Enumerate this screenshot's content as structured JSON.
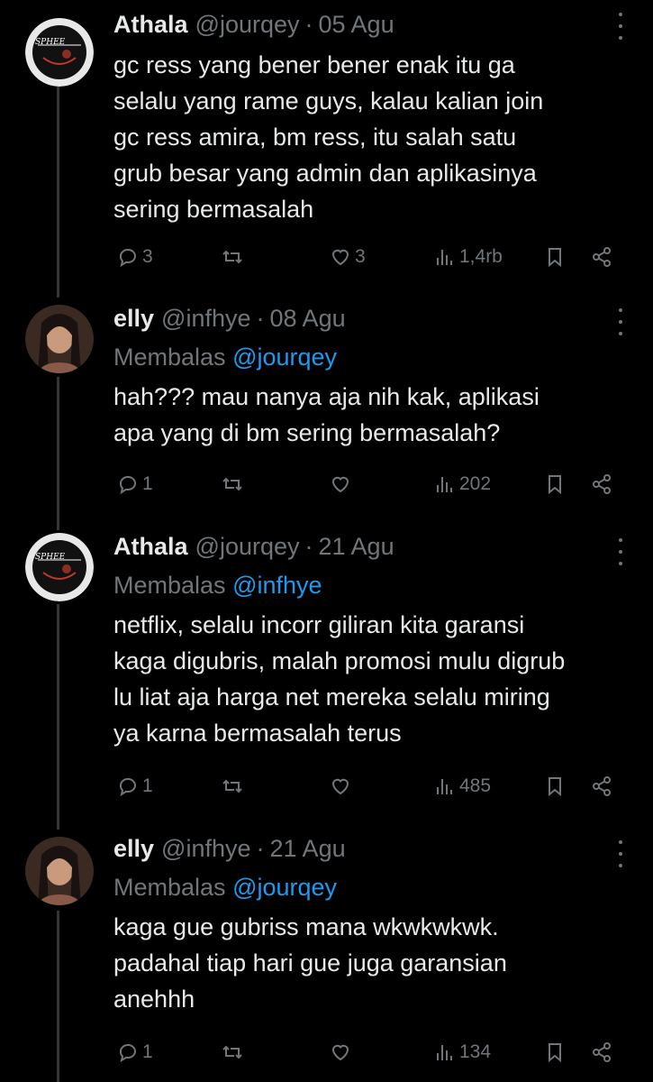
{
  "tweets": [
    {
      "name": "Athala",
      "handle": "@jourqey",
      "sep": "·",
      "date": "05 Agu",
      "reply_prefix": "",
      "reply_to": "",
      "lines": [
        "gc ress yang bener bener enak itu ga",
        "selalu yang rame guys, kalau kalian join",
        "gc ress amira, bm ress, itu salah satu",
        "grub besar yang admin dan aplikasinya",
        "sering bermasalah"
      ],
      "replies": "3",
      "retweets": "",
      "likes": "3",
      "views": "1,4rb",
      "avatar": "dark-logo-avatar"
    },
    {
      "name": "elly",
      "handle": "@infhye",
      "sep": "·",
      "date": "08 Agu",
      "reply_prefix": "Membalas",
      "reply_to": "@jourqey",
      "lines": [
        "hah??? mau nanya aja nih kak, aplikasi",
        "apa yang di bm sering bermasalah?"
      ],
      "replies": "1",
      "retweets": "",
      "likes": "",
      "views": "202",
      "avatar": "photo-avatar"
    },
    {
      "name": "Athala",
      "handle": "@jourqey",
      "sep": "·",
      "date": "21 Agu",
      "reply_prefix": "Membalas",
      "reply_to": "@infhye",
      "lines": [
        "netflix, selalu incorr giliran kita garansi",
        "kaga digubris, malah promosi mulu digrub",
        "lu liat aja harga net mereka selalu miring",
        "ya karna bermasalah terus"
      ],
      "replies": "1",
      "retweets": "",
      "likes": "",
      "views": "485",
      "avatar": "dark-logo-avatar"
    },
    {
      "name": "elly",
      "handle": "@infhye",
      "sep": "·",
      "date": "21 Agu",
      "reply_prefix": "Membalas",
      "reply_to": "@jourqey",
      "lines": [
        "kaga gue gubriss mana wkwkwkwk.",
        "padahal tiap hari gue juga garansian",
        "anehhh"
      ],
      "replies": "1",
      "retweets": "",
      "likes": "",
      "views": "134",
      "avatar": "photo-avatar"
    }
  ],
  "colors": {
    "background": "#000000",
    "text": "#e7e9ea",
    "muted": "#71767b",
    "mention": "#1d9bf0",
    "thread_line": "#333639"
  }
}
